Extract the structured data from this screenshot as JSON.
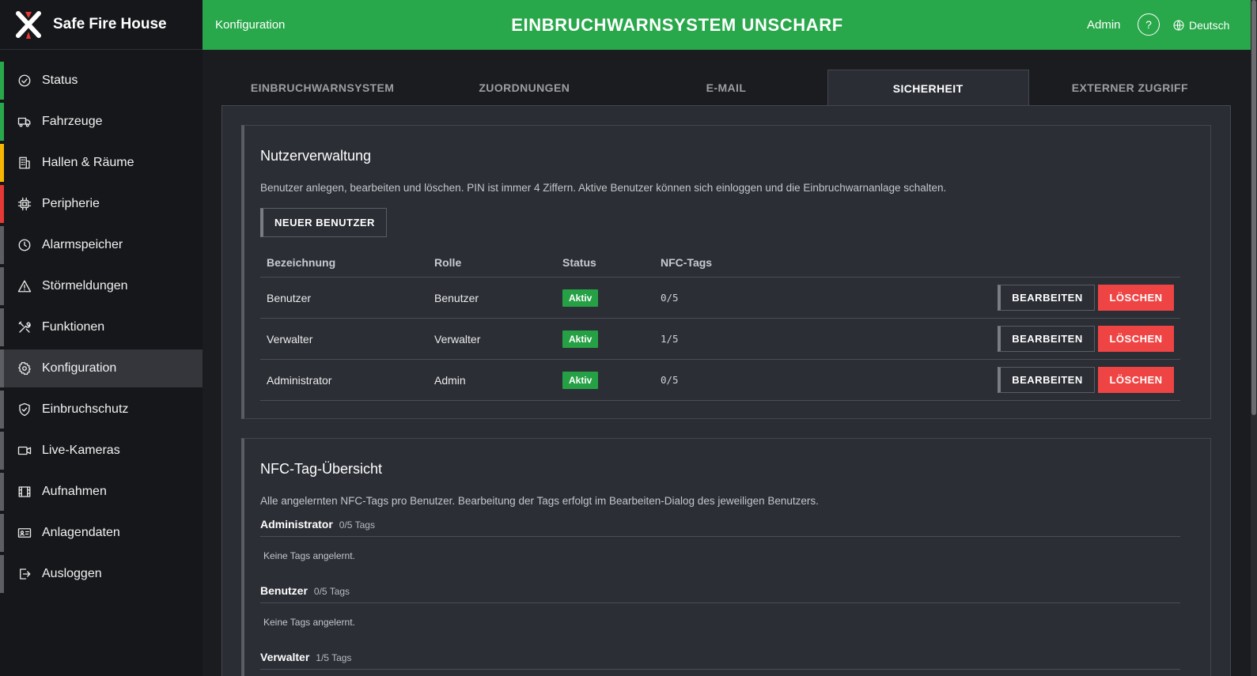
{
  "app": {
    "name": "Safe Fire House"
  },
  "sidebar": {
    "items": [
      {
        "label": "Status",
        "icon": "check-circle-icon",
        "color": "#28a84a"
      },
      {
        "label": "Fahrzeuge",
        "icon": "truck-icon",
        "color": "#28a84a"
      },
      {
        "label": "Hallen & Räume",
        "icon": "building-icon",
        "color": "#f5b800"
      },
      {
        "label": "Peripherie",
        "icon": "chip-icon",
        "color": "#e53935"
      },
      {
        "label": "Alarmspeicher",
        "icon": "clock-icon",
        "color": "#5c5e64"
      },
      {
        "label": "Störmeldungen",
        "icon": "warning-icon",
        "color": "#5c5e64"
      },
      {
        "label": "Funktionen",
        "icon": "tools-icon",
        "color": "#5c5e64"
      },
      {
        "label": "Konfiguration",
        "icon": "gear-icon",
        "color": "#5c5e64"
      },
      {
        "label": "Einbruchschutz",
        "icon": "shield-icon",
        "color": "#5c5e64"
      },
      {
        "label": "Live-Kameras",
        "icon": "camera-icon",
        "color": "#5c5e64"
      },
      {
        "label": "Aufnahmen",
        "icon": "film-icon",
        "color": "#5c5e64"
      },
      {
        "label": "Anlagendaten",
        "icon": "id-card-icon",
        "color": "#5c5e64"
      },
      {
        "label": "Ausloggen",
        "icon": "logout-icon",
        "color": "#5c5e64"
      }
    ]
  },
  "header": {
    "breadcrumb": "Konfiguration",
    "title": "EINBRUCHWARNSYSTEM UNSCHARF",
    "user": "Admin",
    "help": "?",
    "language": "Deutsch",
    "color": "#28a84a"
  },
  "tabs": [
    {
      "label": "EINBRUCHWARNSYSTEM"
    },
    {
      "label": "ZUORDNUNGEN"
    },
    {
      "label": "E-MAIL"
    },
    {
      "label": "SICHERHEIT"
    },
    {
      "label": "EXTERNER ZUGRIFF"
    }
  ],
  "users": {
    "title": "Nutzerverwaltung",
    "description": "Benutzer anlegen, bearbeiten und löschen. PIN ist immer 4 Ziffern. Aktive Benutzer können sich einloggen und die Einbruchwarnanlage schalten.",
    "new_button": "NEUER BENUTZER",
    "columns": [
      "Bezeichnung",
      "Rolle",
      "Status",
      "NFC-Tags"
    ],
    "edit_label": "BEARBEITEN",
    "delete_label": "LÖSCHEN",
    "rows": [
      {
        "name": "Benutzer",
        "role": "Benutzer",
        "status": "Aktiv",
        "nfc": "0/5"
      },
      {
        "name": "Verwalter",
        "role": "Verwalter",
        "status": "Aktiv",
        "nfc": "1/5"
      },
      {
        "name": "Administrator",
        "role": "Admin",
        "status": "Aktiv",
        "nfc": "0/5"
      }
    ]
  },
  "nfc": {
    "title": "NFC-Tag-Übersicht",
    "description": "Alle angelernten NFC-Tags pro Benutzer. Bearbeitung der Tags erfolgt im Bearbeiten-Dialog des jeweiligen Benutzers.",
    "groups": [
      {
        "name": "Administrator",
        "count": "0/5 Tags",
        "empty": "Keine Tags angelernt."
      },
      {
        "name": "Benutzer",
        "count": "0/5 Tags",
        "empty": "Keine Tags angelernt."
      },
      {
        "name": "Verwalter",
        "count": "1/5 Tags",
        "empty": ""
      }
    ]
  }
}
